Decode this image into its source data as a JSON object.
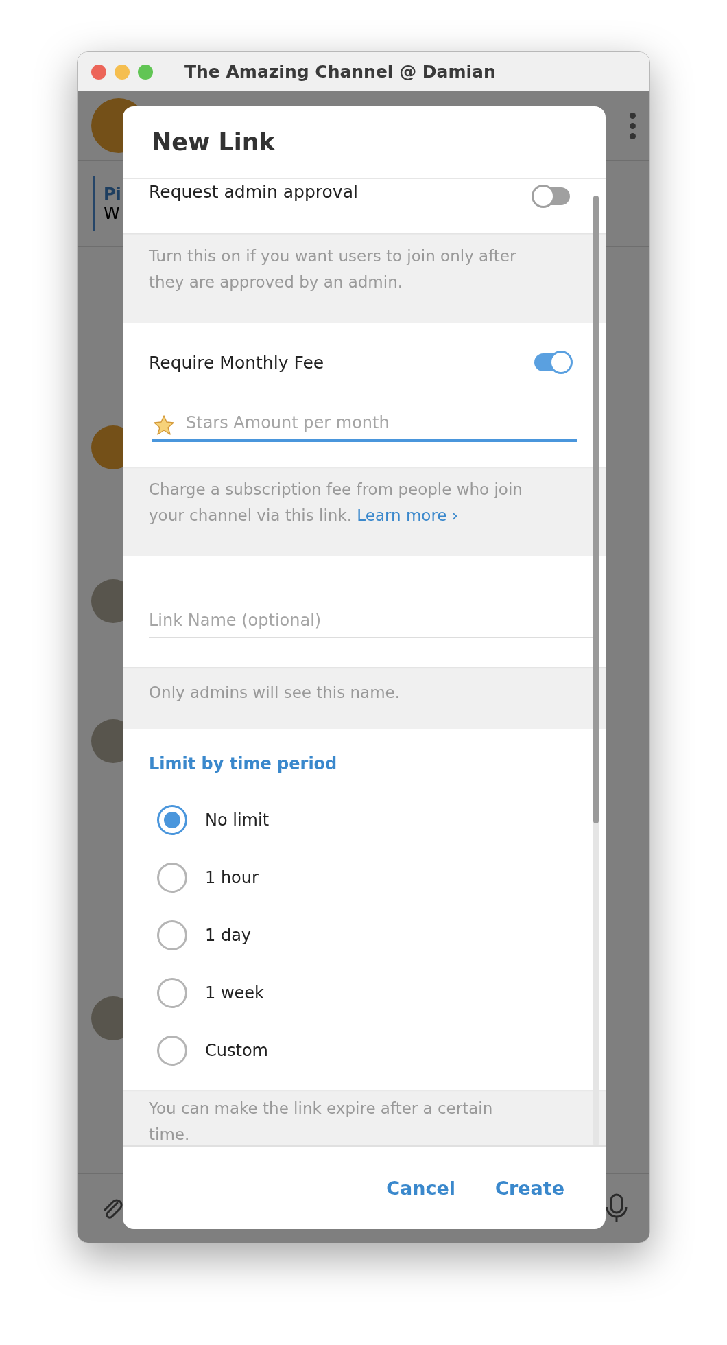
{
  "window": {
    "title": "The Amazing Channel @ Damian"
  },
  "background": {
    "pinned": {
      "title": "Pi",
      "text": "W"
    }
  },
  "dialog": {
    "title": "New Link",
    "approval": {
      "label": "Request admin approval",
      "on": false,
      "note": "Turn this on if you want users to join only after they are approved by an admin."
    },
    "fee": {
      "label": "Require Monthly Fee",
      "on": true,
      "placeholder": "Stars Amount per month",
      "focused": true,
      "note": "Charge a subscription fee from people who join your channel via this link.",
      "link": "Learn more ›"
    },
    "name": {
      "placeholder": "Link Name (optional)",
      "focused": false,
      "note": "Only admins will see this name."
    },
    "limit": {
      "header": "Limit by time period",
      "options": [
        {
          "label": "No limit",
          "selected": true
        },
        {
          "label": "1 hour",
          "selected": false
        },
        {
          "label": "1 day",
          "selected": false
        },
        {
          "label": "1 week",
          "selected": false
        },
        {
          "label": "Custom",
          "selected": false
        }
      ],
      "note": "You can make the link expire after a certain time."
    },
    "buttons": [
      {
        "label": "Cancel"
      },
      {
        "label": "Create"
      }
    ]
  }
}
